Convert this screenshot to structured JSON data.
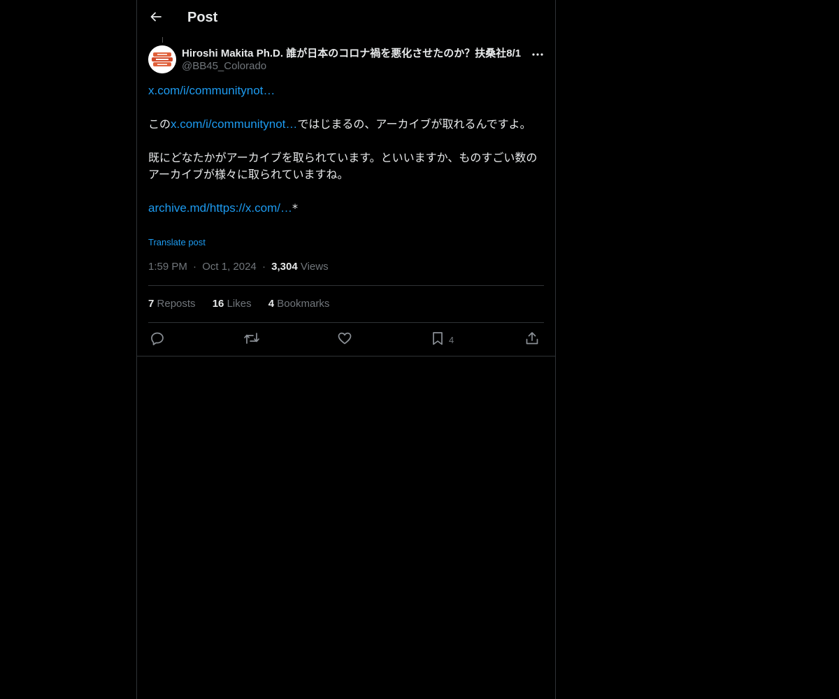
{
  "header": {
    "title": "Post"
  },
  "author": {
    "display_name": "Hiroshi Makita Ph.D. 誰が日本のコロナ禍を悪化させたのか？扶桑社8/1",
    "handle": "@BB45_Colorado"
  },
  "post": {
    "link1": "x.com/i/communitynot…",
    "para1_prefix": "この",
    "para1_link": "x.com/i/communitynot…",
    "para1_suffix": "ではじまるの、アーカイブが取れるんですよ。",
    "para2": "既にどなたかがアーカイブを取られています。といいますか、ものすごい数のアーカイブが様々に取られていますね。",
    "link2": "archive.md/https://x.com/…",
    "link2_suffix": "*",
    "translate_label": "Translate post"
  },
  "meta": {
    "time": "1:59 PM",
    "sep1": "·",
    "date": "Oct 1, 2024",
    "sep2": "·",
    "views_count": "3,304",
    "views_label": "Views"
  },
  "stats": {
    "reposts_count": "7",
    "reposts_label": "Reposts",
    "likes_count": "16",
    "likes_label": "Likes",
    "bookmarks_count": "4",
    "bookmarks_label": "Bookmarks"
  },
  "actions": {
    "bookmark_count": "4"
  },
  "colors": {
    "background": "#000000",
    "text": "#e7e9ea",
    "muted": "#71767b",
    "link": "#1d9bf0",
    "border": "#2f3336"
  },
  "icons": {
    "back": "arrow-left-icon",
    "more": "more-horizontal-icon",
    "reply": "reply-icon",
    "repost": "repost-icon",
    "like": "heart-icon",
    "bookmark": "bookmark-icon",
    "share": "share-icon"
  }
}
